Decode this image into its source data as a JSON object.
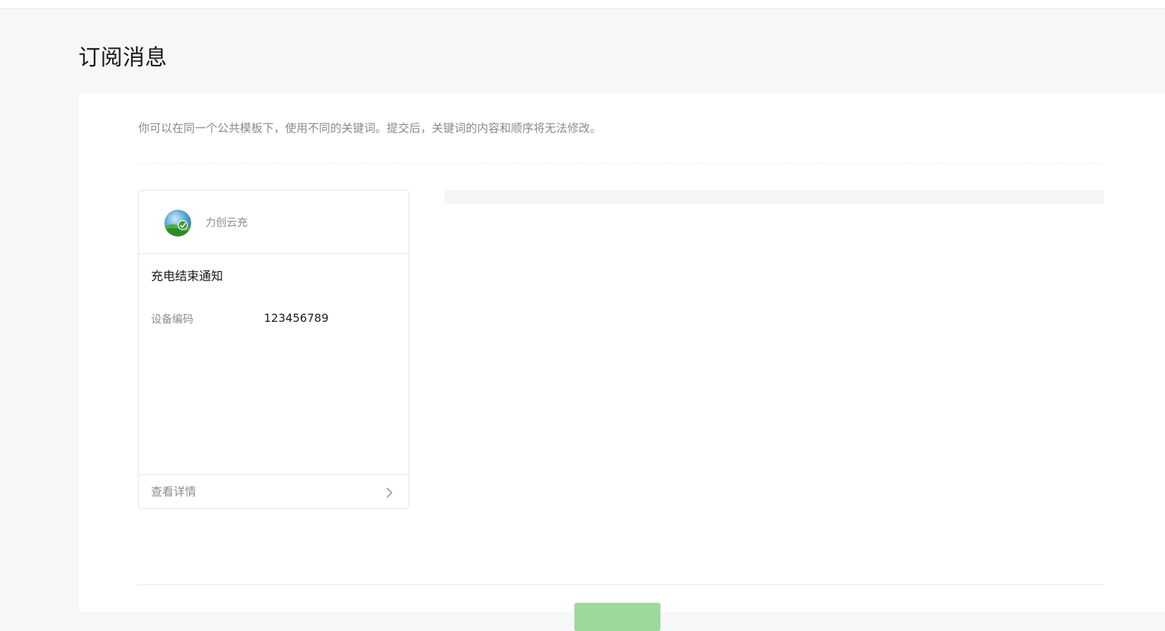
{
  "page": {
    "title": "订阅消息"
  },
  "panel": {
    "description": "你可以在同一个公共模板下，使用不同的关键词。提交后，关键词的内容和顺序将无法修改。"
  },
  "preview_card": {
    "app_name": "力创云充",
    "avatar_icon": "earth-leaf-avatar-icon",
    "template_title": "充电结束通知",
    "fields": [
      {
        "key": "设备编码",
        "value": "123456789"
      }
    ],
    "footer_label": "查看详情",
    "footer_icon": "chevron-right-icon"
  },
  "footer": {
    "submit_label": ""
  },
  "colors": {
    "page_bg": "#f6f7f9",
    "panel_bg": "#ffffff",
    "primary_disabled": "#9ed99c",
    "muted_text": "#8c8c8c"
  }
}
